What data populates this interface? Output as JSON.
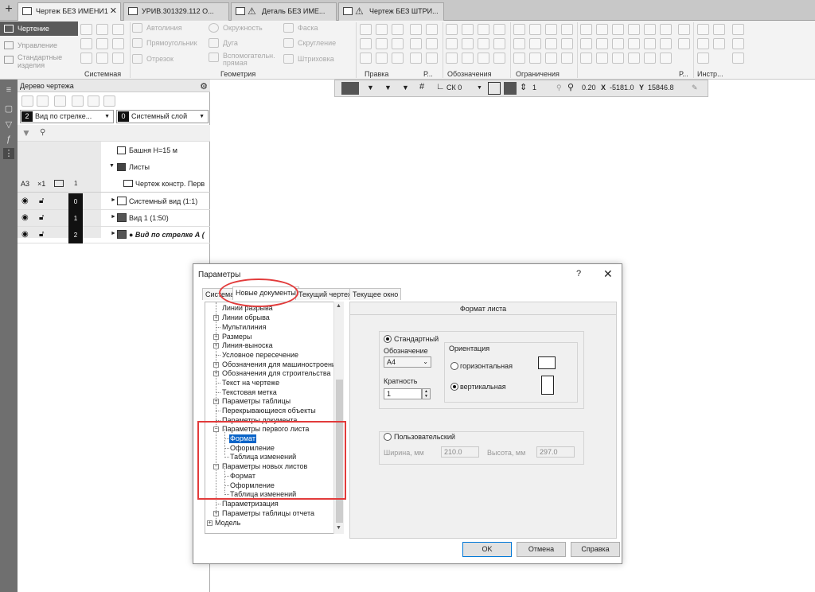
{
  "doc_tabs": [
    {
      "label": "Чертеж БЕЗ ИМЕНИ1",
      "active": true
    },
    {
      "label": "УРИВ.301329.112 О...",
      "active": false
    },
    {
      "label": "Деталь БЕЗ ИМЕ...",
      "active": false
    },
    {
      "label": "Чертеж БЕЗ ШТРИ...",
      "active": false
    }
  ],
  "ribbon": {
    "modes": [
      "Чертение",
      "Управление",
      "Стандартные изделия"
    ],
    "geometry": {
      "buttons": [
        "Автолиния",
        "Прямоугольник",
        "Отрезок",
        "Окружность",
        "Дуга",
        "Вспомогательн. прямая",
        "Фаска",
        "Скругление",
        "Штриховка"
      ]
    },
    "groups": [
      "Системная",
      "Геометрия",
      "Правка",
      "Р...",
      "Обозначения",
      "Ограничения",
      "Р...",
      "Инстр..."
    ]
  },
  "tree": {
    "title": "Дерево чертежа",
    "view_combo": {
      "num": "2",
      "label": "Вид по стрелке..."
    },
    "layer_combo": {
      "num": "0",
      "label": "Системный слой"
    },
    "items": {
      "bashnya": "Башня Н=15 м",
      "listy": "Листы",
      "format": "А3",
      "mult": "×1",
      "sheet_num": "1",
      "sheet_name": "Чертеж констр. Перв"
    },
    "views": [
      {
        "num": "0",
        "label": "Системный вид (1:1)"
      },
      {
        "num": "1",
        "label": "Вид 1 (1:50)"
      },
      {
        "num": "2",
        "label": "● Вид по стрелке А ("
      }
    ]
  },
  "canvas_bar": {
    "sk": "СК 0",
    "count": "1",
    "zoom": "0.20",
    "x_label": "X",
    "x": "-5181.0",
    "y_label": "Y",
    "y": "15846.8"
  },
  "dialog": {
    "title": "Параметры",
    "help": "?",
    "tabs": [
      "Система",
      "Новые документы",
      "Текущий чертеж",
      "Текущее окно"
    ],
    "tree_items": [
      "Линии разрыва",
      "Линии обрыва",
      "Мультилиния",
      "Размеры",
      "Линия-выноска",
      "Условное пересечение",
      "Обозначения для машиностроения",
      "Обозначения для строительства",
      "Текст на чертеже",
      "Текстовая метка",
      "Параметры таблицы",
      "Перекрывающиеся объекты",
      "Параметры документа",
      "Параметры первого листа",
      "Формат",
      "Оформление",
      "Таблица изменений",
      "Параметры новых листов",
      "Формат",
      "Оформление",
      "Таблица изменений",
      "Параметризация",
      "Параметры таблицы отчета",
      "Модель"
    ],
    "panel": {
      "header": "Формат листа",
      "standard": "Стандартный",
      "designation_label": "Обозначение",
      "designation_value": "А4",
      "multiplicity_label": "Кратность",
      "multiplicity_value": "1",
      "orientation_label": "Ориентация",
      "horizontal": "горизонтальная",
      "vertical": "вертикальная",
      "custom": "Пользовательский",
      "width_label": "Ширина, мм",
      "width_value": "210.0",
      "height_label": "Высота, мм",
      "height_value": "297.0"
    },
    "buttons": {
      "ok": "OK",
      "cancel": "Отмена",
      "help": "Справка"
    }
  },
  "colors": {
    "highlight": "#e23b3b",
    "selection": "#0a64c8"
  }
}
